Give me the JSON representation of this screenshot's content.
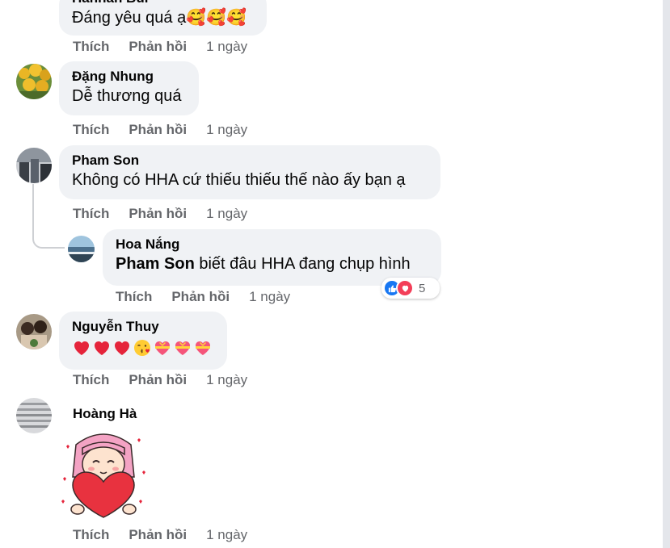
{
  "labels": {
    "like": "Thích",
    "reply": "Phản hồi"
  },
  "comments": [
    {
      "author": "Hannah Bui",
      "text": "Đáng yêu quá ạ🥰🥰🥰",
      "time": "1 ngày"
    },
    {
      "author": "Đặng Nhung",
      "text": "Dễ thương quá",
      "time": "1 ngày"
    },
    {
      "author": "Pham Son",
      "text": "Không có HHA cứ thiếu thiếu thế nào ấy bạn ạ",
      "time": "1 ngày",
      "replies": [
        {
          "author": "Hoa Nắng",
          "mention": "Pham Son",
          "text": "biết đâu HHA đang chụp hình",
          "time": "1 ngày",
          "reactions": {
            "types": [
              "like",
              "love"
            ],
            "count": "5"
          }
        }
      ]
    },
    {
      "author": "Nguyễn Thuy",
      "emojis": [
        "red-heart",
        "red-heart",
        "red-heart",
        "kissing-face",
        "heart-with-ribbon",
        "heart-with-ribbon",
        "heart-with-ribbon"
      ],
      "time": "1 ngày"
    },
    {
      "author": "Hoàng Hà",
      "sticker": "girl-hugging-heart-sticker",
      "time": "1 ngày"
    }
  ],
  "colors": {
    "bubble": "#f0f2f5",
    "secondary_text": "#65676b",
    "like_blue": "#1877f2",
    "love_red": "#f33e58"
  }
}
